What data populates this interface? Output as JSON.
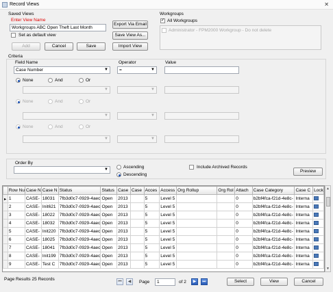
{
  "window": {
    "title": "Record Views",
    "close_glyph": "✕"
  },
  "saved_views": {
    "group_label": "Saved Views",
    "enter_view_name_label": "Enter View Name",
    "view_name_value": "Workgroups ABC Open Theft Last Month",
    "default_view_label": "Set as default view",
    "add_label": "Add",
    "cancel_label": "Cancel",
    "save_label": "Save",
    "export_label": "Export Via Email",
    "save_as_label": "Save View As...",
    "import_label": "Import View"
  },
  "workgroups": {
    "label": "Workgroups",
    "all_label": "All Workgroups",
    "all_checked": "✓",
    "item_label": "Administrator - FPM2000 Workgroup - Do not delete"
  },
  "criteria": {
    "label": "Criteria",
    "field_name_header": "Field Name",
    "operator_header": "Operator",
    "value_header": "Value",
    "row1": {
      "field": "Case Number",
      "operator": "="
    },
    "conj": {
      "none": "None",
      "and": "And",
      "or": "Or"
    }
  },
  "order_by": {
    "label": "Order By",
    "ascending_label": "Ascending",
    "descending_label": "Descending",
    "archived_label": "Include Archived Records",
    "preview_label": "Preview"
  },
  "grid": {
    "columns": [
      "Row Nu",
      "Case N",
      "Case N",
      "Status",
      "Status",
      "Case",
      "Case",
      "Acces",
      "Access",
      "Org Rollup",
      "Org Rol",
      "Attach",
      "Case Category",
      "Case C",
      "Lock"
    ],
    "rows": [
      [
        "1",
        "CASE-",
        "18031",
        "7fb3d0c7-0929-4aec",
        "Open",
        "2013",
        "",
        "5",
        "Level 5",
        "",
        "",
        "0",
        "b2bf4fca-f21d-4e8c-",
        "Interna"
      ],
      [
        "2",
        "CASE-",
        "Init621",
        "7fb3d0c7-0929-4aec",
        "Open",
        "2013",
        "",
        "5",
        "Level 5",
        "",
        "",
        "0",
        "b2bf4fca-f21d-4e8c-",
        "Interna"
      ],
      [
        "3",
        "CASE-",
        "18022",
        "7fb3d0c7-0929-4aec",
        "Open",
        "2013",
        "",
        "5",
        "Level 5",
        "",
        "",
        "0",
        "b2bf4fca-f21d-4e8c-",
        "Interna"
      ],
      [
        "4",
        "CASE-",
        "18032",
        "7fb3d0c7-0929-4aec",
        "Open",
        "2013",
        "",
        "5",
        "Level 5",
        "",
        "",
        "0",
        "b2bf4fca-f21d-4e8c-",
        "Interna"
      ],
      [
        "5",
        "CASE-",
        "Init220",
        "7fb3d0c7-0929-4aec",
        "Open",
        "2013",
        "",
        "5",
        "Level 5",
        "",
        "",
        "0",
        "b2bf4fca-f21d-4e8c-",
        "Interna"
      ],
      [
        "6",
        "CASE-",
        "18025",
        "7fb3d0c7-0929-4aec",
        "Open",
        "2013",
        "",
        "5",
        "Level 5",
        "",
        "",
        "0",
        "b2bf4fca-f21d-4e8c-",
        "Interna"
      ],
      [
        "7",
        "CASE-",
        "18041",
        "7fb3d0c7-0929-4aec",
        "Open",
        "2013",
        "",
        "5",
        "Level 5",
        "",
        "",
        "0",
        "b2bf4fca-f21d-4e8c-",
        "Interna"
      ],
      [
        "8",
        "CASE-",
        "Init199",
        "7fb3d0c7-0929-4aec",
        "Open",
        "2013",
        "",
        "5",
        "Level 5",
        "",
        "",
        "0",
        "b2bf4fca-f21d-4e8c-",
        "Interna"
      ],
      [
        "9",
        "CASE-",
        "Test C",
        "7fb3d0c7-0929-4aec",
        "Open",
        "2013",
        "",
        "5",
        "Level 5",
        "",
        "",
        "0",
        "b2bf4fca-f21d-4e8c-",
        "Interna"
      ]
    ],
    "current_row_marker": "▸"
  },
  "footer": {
    "page_results": "Page Results 25 Records",
    "page_label": "Page",
    "page_value": "1",
    "of_label": "of 2",
    "select_label": "Select",
    "view_label": "View",
    "cancel_label": "Cancel"
  }
}
